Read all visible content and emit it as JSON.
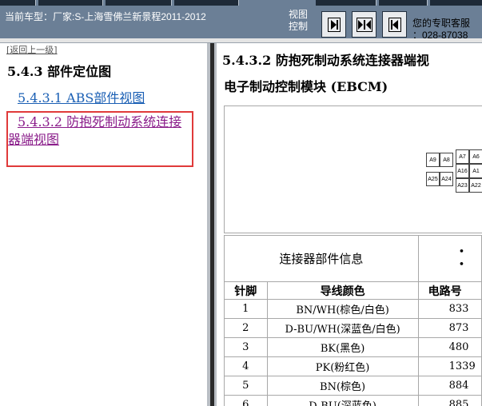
{
  "header": {
    "car_label": "当前车型：厂家:S-上海雪佛兰新景程2011-2012",
    "view_control_line1": "视图",
    "view_control_line2": "控制",
    "service_line1": "您的专职客服",
    "service_line2": "：028-87038"
  },
  "nav": {
    "back_link": "[返回上一级]",
    "section_title": "5.4.3 部件定位图",
    "items": [
      {
        "label": "5.4.3.1 ABS部件视图"
      },
      {
        "label": "5.4.3.2 防抱死制动系统连接器端视图"
      }
    ]
  },
  "content": {
    "title": "5.4.3.2 防抱死制动系统连接器端视",
    "subtitle": "电子制动控制模块 (EBCM)",
    "connector_pins": {
      "row1": [
        "A9",
        "A8",
        "A7",
        "A6"
      ],
      "row2": [
        "A16",
        "A1"
      ],
      "row3": [
        "A25",
        "A24",
        "A23",
        "A22"
      ]
    },
    "info_label": "连接器部件信息",
    "info_bullets": [
      "•",
      "•"
    ],
    "table": {
      "headers": [
        "针脚",
        "导线颜色",
        "电路号"
      ],
      "rows": [
        {
          "pin": "1",
          "color": "BN/WH(棕色/白色)",
          "circuit": "833"
        },
        {
          "pin": "2",
          "color": "D-BU/WH(深蓝色/白色)",
          "circuit": "873"
        },
        {
          "pin": "3",
          "color": "BK(黑色)",
          "circuit": "480"
        },
        {
          "pin": "4",
          "color": "PK(粉红色)",
          "circuit": "1339"
        },
        {
          "pin": "5",
          "color": "BN(棕色)",
          "circuit": "884"
        },
        {
          "pin": "6",
          "color": "D-BU(深蓝色)",
          "circuit": "885"
        }
      ]
    }
  },
  "colors": {
    "header_bg": "#6b7f96",
    "link_blue": "#1a5fb4",
    "visited_purple": "#8a1c8a",
    "highlight_red": "#e03a3a"
  },
  "icons": [
    "next-page-icon",
    "expand-icon",
    "prev-page-icon"
  ]
}
